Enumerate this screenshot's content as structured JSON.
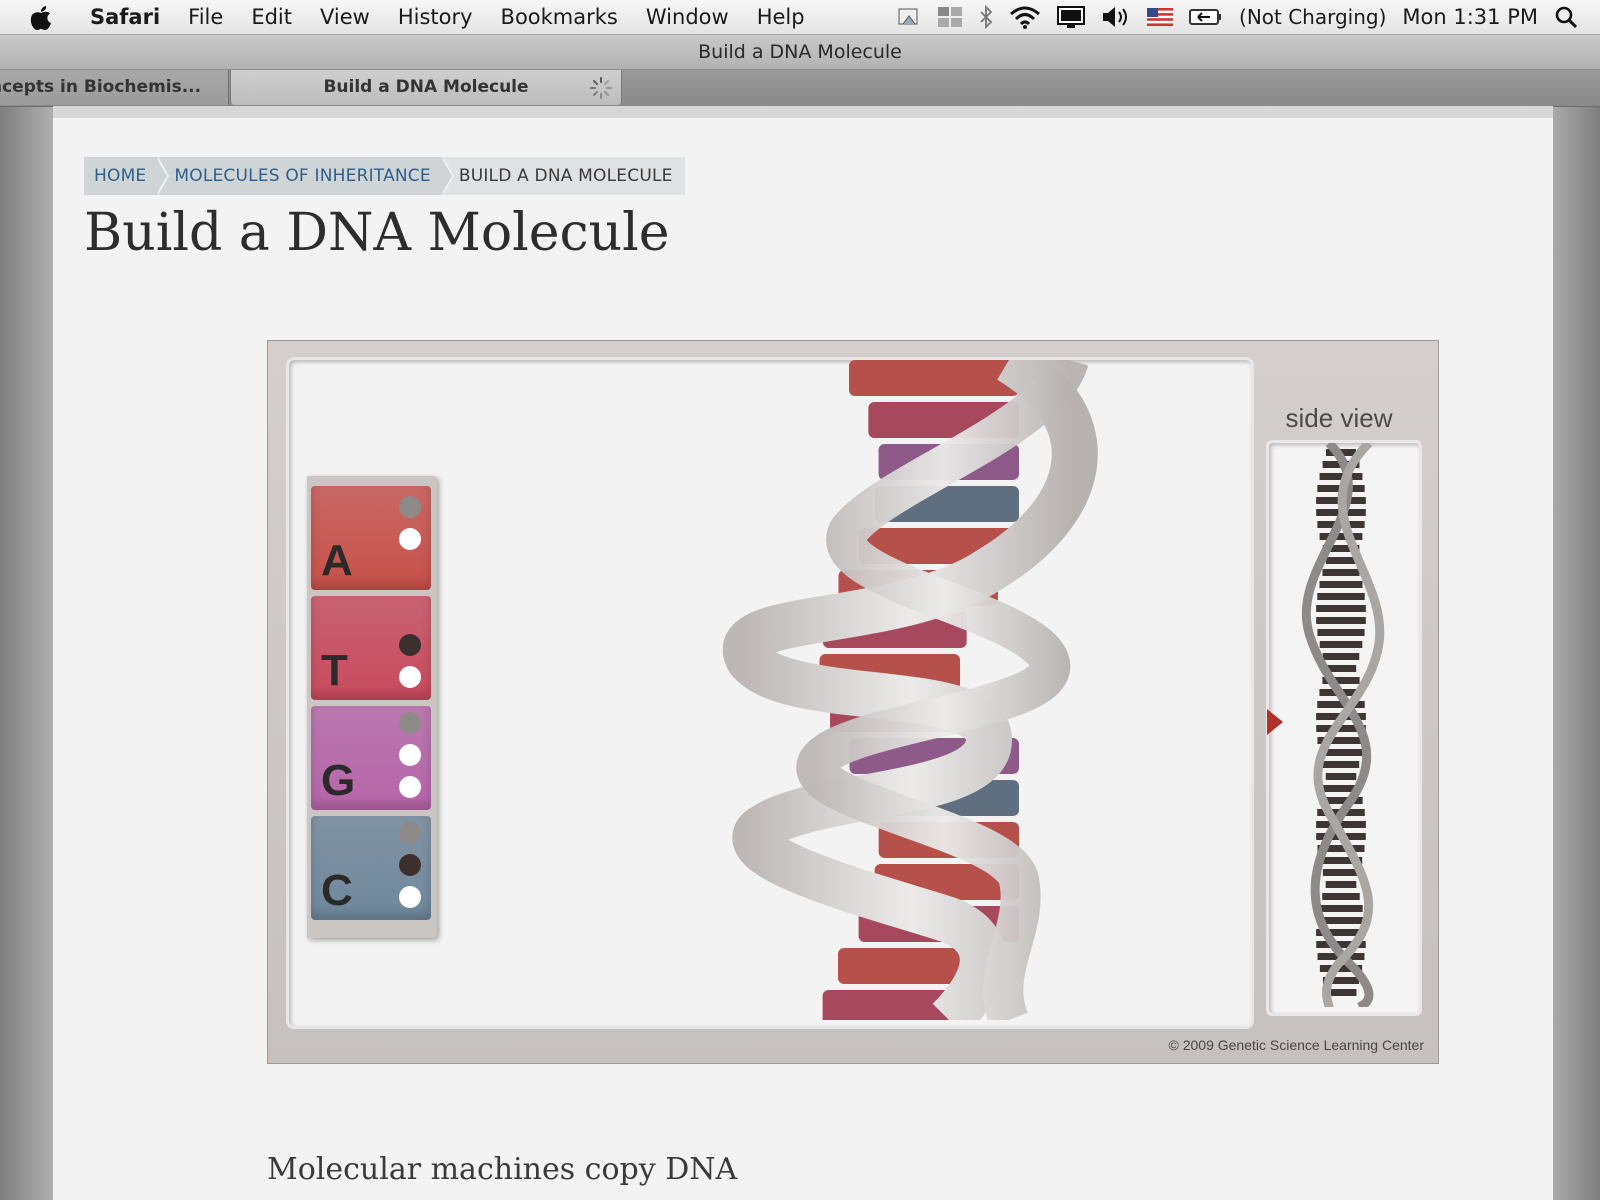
{
  "menubar": {
    "app_name": "Safari",
    "items": [
      "File",
      "Edit",
      "View",
      "History",
      "Bookmarks",
      "Window",
      "Help"
    ],
    "battery_status": "(Not Charging)",
    "clock": "Mon 1:31 PM",
    "icons": [
      "apple-icon",
      "grab-icon",
      "spaces-icon",
      "bluetooth-icon",
      "wifi-icon",
      "display-icon",
      "volume-icon",
      "us-flag-icon",
      "battery-icon",
      "spotlight-icon"
    ]
  },
  "window": {
    "title": "Build a DNA Molecule"
  },
  "tabs": [
    {
      "label": "ncepts in Biochemis..."
    },
    {
      "label": "Build a DNA Molecule"
    }
  ],
  "breadcrumb": {
    "items": [
      "HOME",
      "MOLECULES OF INHERITANCE",
      "BUILD A DNA MOLECULE"
    ]
  },
  "page": {
    "title": "Build a DNA Molecule",
    "section_heading": "Molecular machines copy DNA"
  },
  "module": {
    "bases": [
      {
        "letter": "A",
        "color": "#c8504a"
      },
      {
        "letter": "T",
        "color": "#c84a5e"
      },
      {
        "letter": "G",
        "color": "#b665a9"
      },
      {
        "letter": "C",
        "color": "#6f879c"
      }
    ],
    "side_view_label": "side view",
    "copyright": "© 2009 Genetic Science Learning Center",
    "colors": {
      "adenine": "#b6504a",
      "thymine": "#a8485e",
      "guanine": "#8d5a8a",
      "cytosine": "#5f6f80",
      "backbone": "#d9d6d4",
      "marker": "#b0302a"
    }
  }
}
